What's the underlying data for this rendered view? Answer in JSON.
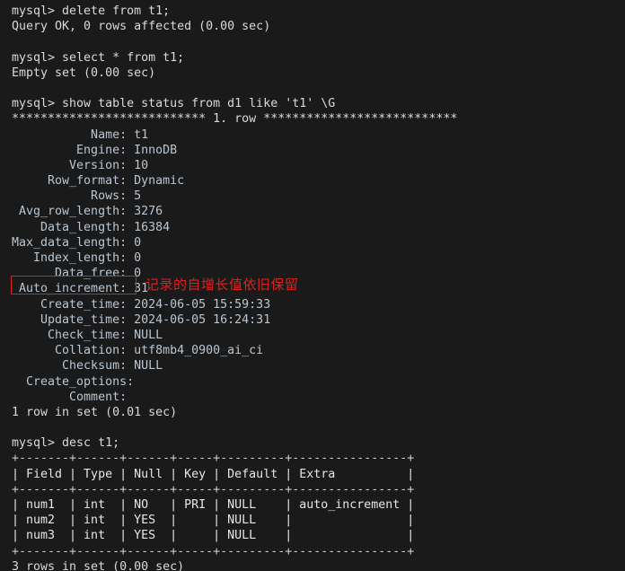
{
  "terminal": {
    "background_color": "#1a1a1a",
    "text_color": "#d9d9d9",
    "annotation_color": "#e02020",
    "label_color": "#b9c6d2"
  },
  "session": {
    "cmd_delete": "mysql> delete from t1;",
    "out_delete": "Query OK, 0 rows affected (0.00 sec)",
    "cmd_select": "mysql> select * from t1;",
    "out_select": "Empty set (0.00 sec)",
    "cmd_status": "mysql> show table status from d1 like 't1' \\G",
    "status_separator": "*************************** 1. row ***************************",
    "status_rows_label": "1 row in set (0.01 sec)",
    "cmd_desc": "mysql> desc t1;",
    "desc_rows_label": "3 rows in set (0.00 sec)"
  },
  "table_status": {
    "fields": [
      {
        "label": "Name",
        "value": "t1"
      },
      {
        "label": "Engine",
        "value": "InnoDB"
      },
      {
        "label": "Version",
        "value": "10"
      },
      {
        "label": "Row_format",
        "value": "Dynamic"
      },
      {
        "label": "Rows",
        "value": "5"
      },
      {
        "label": "Avg_row_length",
        "value": "3276"
      },
      {
        "label": "Data_length",
        "value": "16384"
      },
      {
        "label": "Max_data_length",
        "value": "0"
      },
      {
        "label": "Index_length",
        "value": "0"
      },
      {
        "label": "Data_free",
        "value": "0"
      },
      {
        "label": "Auto_increment",
        "value": "31"
      },
      {
        "label": "Create_time",
        "value": "2024-06-05 15:59:33"
      },
      {
        "label": "Update_time",
        "value": "2024-06-05 16:24:31"
      },
      {
        "label": "Check_time",
        "value": "NULL"
      },
      {
        "label": "Collation",
        "value": "utf8mb4_0900_ai_ci"
      },
      {
        "label": "Checksum",
        "value": "NULL"
      },
      {
        "label": "Create_options",
        "value": ""
      },
      {
        "label": "Comment",
        "value": ""
      }
    ],
    "lines": [
      "           Name: t1",
      "         Engine: InnoDB",
      "        Version: 10",
      "     Row_format: Dynamic",
      "           Rows: 5",
      " Avg_row_length: 3276",
      "    Data_length: 16384",
      "Max_data_length: 0",
      "   Index_length: 0",
      "      Data_free: 0",
      " Auto_increment: 31",
      "    Create_time: 2024-06-05 15:59:33",
      "    Update_time: 2024-06-05 16:24:31",
      "     Check_time: NULL",
      "      Collation: utf8mb4_0900_ai_ci",
      "       Checksum: NULL",
      "  Create_options:",
      "        Comment:"
    ]
  },
  "desc_table": {
    "border": "+-------+------+------+-----+---------+----------------+",
    "header": "| Field | Type | Null | Key | Default | Extra          |",
    "columns": [
      "Field",
      "Type",
      "Null",
      "Key",
      "Default",
      "Extra"
    ],
    "rows": [
      {
        "field": "num1",
        "type": "int",
        "null": "NO",
        "key": "PRI",
        "default": "NULL",
        "extra": "auto_increment"
      },
      {
        "field": "num2",
        "type": "int",
        "null": "YES",
        "key": "",
        "default": "NULL",
        "extra": ""
      },
      {
        "field": "num3",
        "type": "int",
        "null": "YES",
        "key": "",
        "default": "NULL",
        "extra": ""
      }
    ],
    "row_lines": [
      "| num1  | int  | NO   | PRI | NULL    | auto_increment |",
      "| num2  | int  | YES  |     | NULL    |                |",
      "| num3  | int  | YES  |     | NULL    |                |"
    ]
  },
  "annotation": {
    "text": "记录的自增长值依旧保留",
    "target_field": "Auto_increment"
  }
}
